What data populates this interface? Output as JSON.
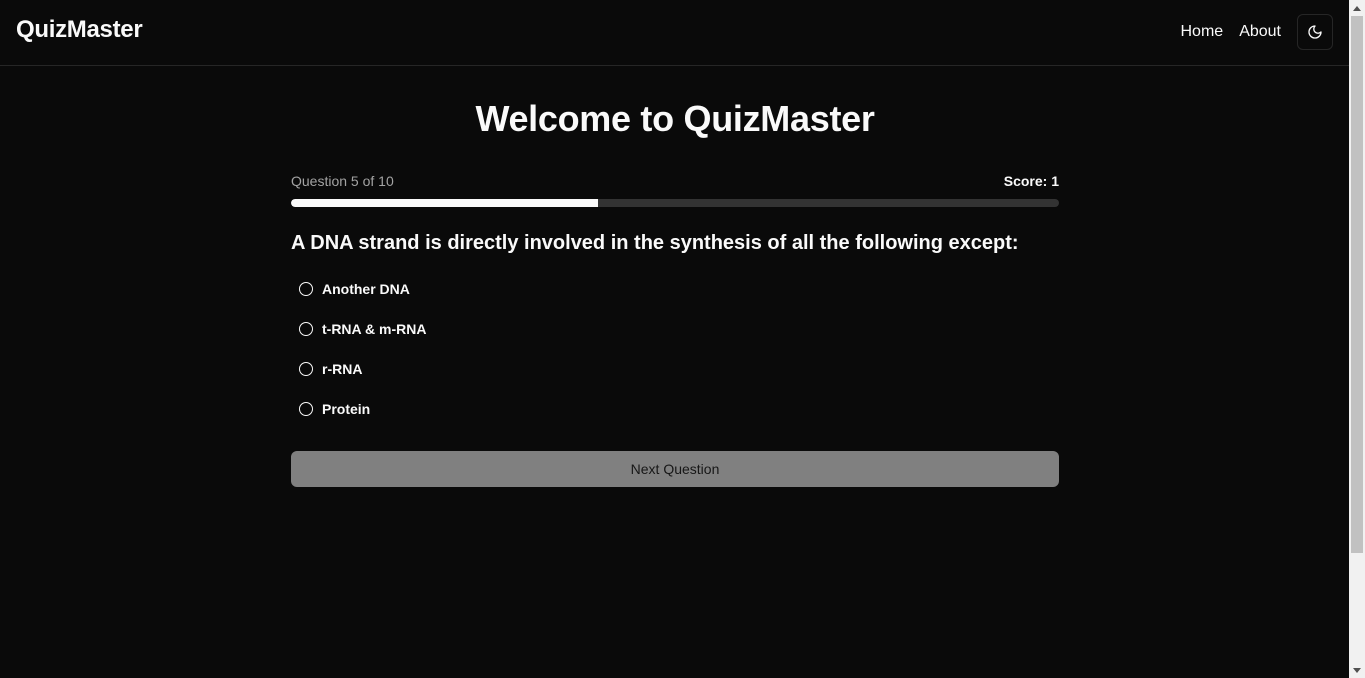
{
  "navbar": {
    "brand": "QuizMaster",
    "links": [
      "Home",
      "About"
    ],
    "theme_icon": "moon-icon"
  },
  "main": {
    "title": "Welcome to QuizMaster",
    "progress_label": "Question 5 of 10",
    "score_label": "Score: 1",
    "progress_fraction": 0.4,
    "question": "A DNA strand is directly involved in the synthesis of all the following except:",
    "options": [
      "Another DNA",
      "t-RNA & m-RNA",
      "r-RNA",
      "Protein"
    ],
    "next_label": "Next Question"
  },
  "colors": {
    "background": "#0a0a0a",
    "foreground": "#fafafa",
    "muted": "#a3a3a3",
    "border": "#262626",
    "button_disabled": "#808080"
  }
}
